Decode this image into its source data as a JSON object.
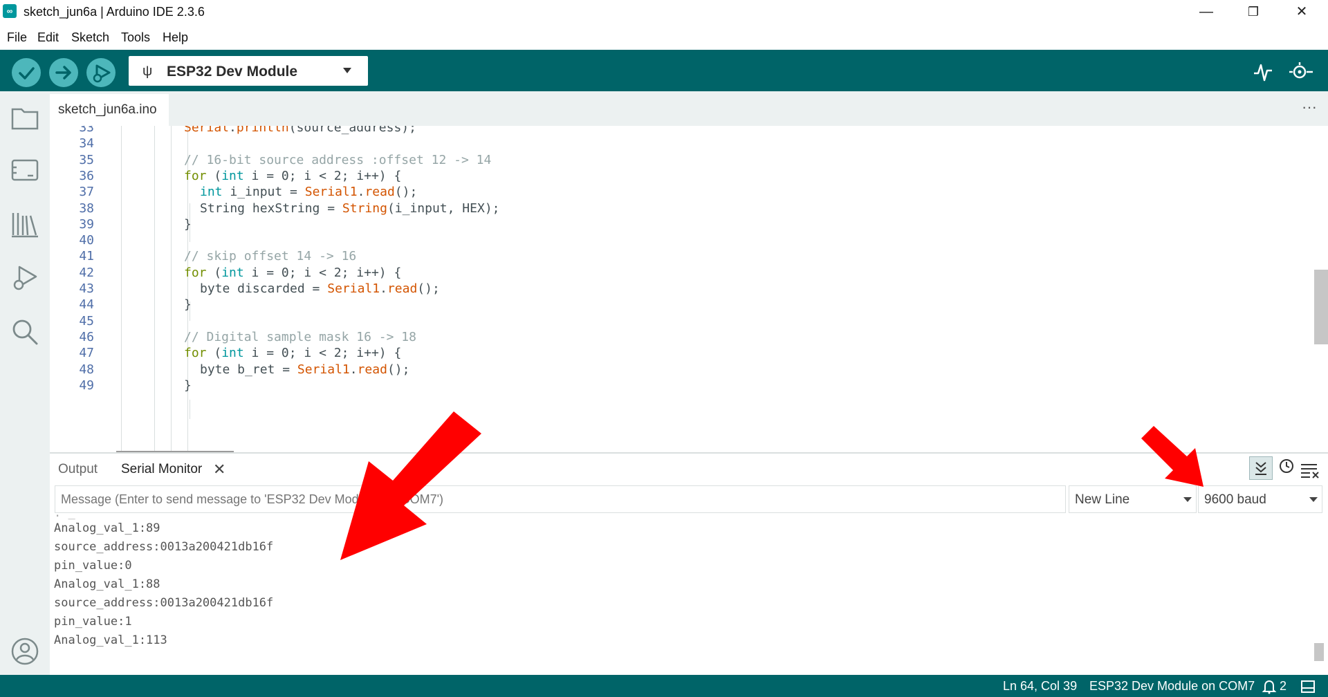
{
  "window": {
    "title": "sketch_jun6a | Arduino IDE 2.3.6",
    "logo": "∞",
    "minimize": "—",
    "restore": "❐",
    "close": "✕"
  },
  "menu": [
    "File",
    "Edit",
    "Sketch",
    "Tools",
    "Help"
  ],
  "toolbar": {
    "board": "ESP32 Dev Module",
    "usb_glyph": "ψ"
  },
  "tabs": {
    "file": "sketch_jun6a.ino",
    "more": "···"
  },
  "editor": {
    "lines": [
      {
        "n": "33",
        "parts": [
          [
            "fn",
            "Serial"
          ],
          [
            "",
            "."
          ],
          [
            "fn",
            "println"
          ],
          [
            "",
            "(source_address);"
          ]
        ],
        "indent": 0
      },
      {
        "n": "34",
        "parts": [],
        "indent": 0
      },
      {
        "n": "35",
        "parts": [
          [
            "cmt",
            "// 16-bit source address :offset 12 -> 14"
          ]
        ],
        "indent": 0
      },
      {
        "n": "36",
        "parts": [
          [
            "kw",
            "for"
          ],
          [
            "",
            " ("
          ],
          [
            "ty",
            "int"
          ],
          [
            "",
            " i = 0; i < 2; i++) {"
          ]
        ],
        "indent": 0
      },
      {
        "n": "37",
        "parts": [
          [
            "ty",
            "int"
          ],
          [
            "",
            " i_input = "
          ],
          [
            "fn",
            "Serial1"
          ],
          [
            "",
            "."
          ],
          [
            "fn",
            "read"
          ],
          [
            "",
            "();"
          ]
        ],
        "indent": 1
      },
      {
        "n": "38",
        "parts": [
          [
            "",
            "String hexString = "
          ],
          [
            "fn",
            "String"
          ],
          [
            "",
            "(i_input, HEX);"
          ]
        ],
        "indent": 1
      },
      {
        "n": "39",
        "parts": [
          [
            "",
            "}"
          ]
        ],
        "indent": 0
      },
      {
        "n": "40",
        "parts": [],
        "indent": 0
      },
      {
        "n": "41",
        "parts": [
          [
            "cmt",
            "// skip offset 14 -> 16"
          ]
        ],
        "indent": 0
      },
      {
        "n": "42",
        "parts": [
          [
            "kw",
            "for"
          ],
          [
            "",
            " ("
          ],
          [
            "ty",
            "int"
          ],
          [
            "",
            " i = 0; i < 2; i++) {"
          ]
        ],
        "indent": 0
      },
      {
        "n": "43",
        "parts": [
          [
            "",
            "byte discarded = "
          ],
          [
            "fn",
            "Serial1"
          ],
          [
            "",
            "."
          ],
          [
            "fn",
            "read"
          ],
          [
            "",
            "();"
          ]
        ],
        "indent": 1
      },
      {
        "n": "44",
        "parts": [
          [
            "",
            "}"
          ]
        ],
        "indent": 0
      },
      {
        "n": "45",
        "parts": [],
        "indent": 0
      },
      {
        "n": "46",
        "parts": [
          [
            "cmt",
            "// Digital sample mask 16 -> 18"
          ]
        ],
        "indent": 0
      },
      {
        "n": "47",
        "parts": [
          [
            "kw",
            "for"
          ],
          [
            "",
            " ("
          ],
          [
            "ty",
            "int"
          ],
          [
            "",
            " i = 0; i < 2; i++) {"
          ]
        ],
        "indent": 0
      },
      {
        "n": "48",
        "parts": [
          [
            "",
            "byte b_ret = "
          ],
          [
            "fn",
            "Serial1"
          ],
          [
            "",
            "."
          ],
          [
            "fn",
            "read"
          ],
          [
            "",
            "();"
          ]
        ],
        "indent": 1
      },
      {
        "n": "49",
        "parts": [
          [
            "",
            "}"
          ]
        ],
        "indent": 0
      }
    ]
  },
  "panel": {
    "output_tab": "Output",
    "serial_tab": "Serial Monitor",
    "close_glyph": "✕",
    "message_placeholder": "Message (Enter to send message to 'ESP32 Dev Module' on 'COM7')",
    "line_ending": "New Line",
    "baud": "9600 baud",
    "serial_lines": [
      "Analog_val_1:89",
      "source_address:0013a200421db16f",
      "pin_value:0",
      "Analog_val_1:88",
      "source_address:0013a200421db16f",
      "pin_value:1",
      "Analog_val_1:113"
    ]
  },
  "status": {
    "cursor": "Ln 64, Col 39",
    "board_port": "ESP32 Dev Module on COM7",
    "notifications": "2"
  },
  "colors": {
    "toolbar": "#006468",
    "button": "#4db7bb",
    "annotation_arrow": "#ff0000"
  }
}
